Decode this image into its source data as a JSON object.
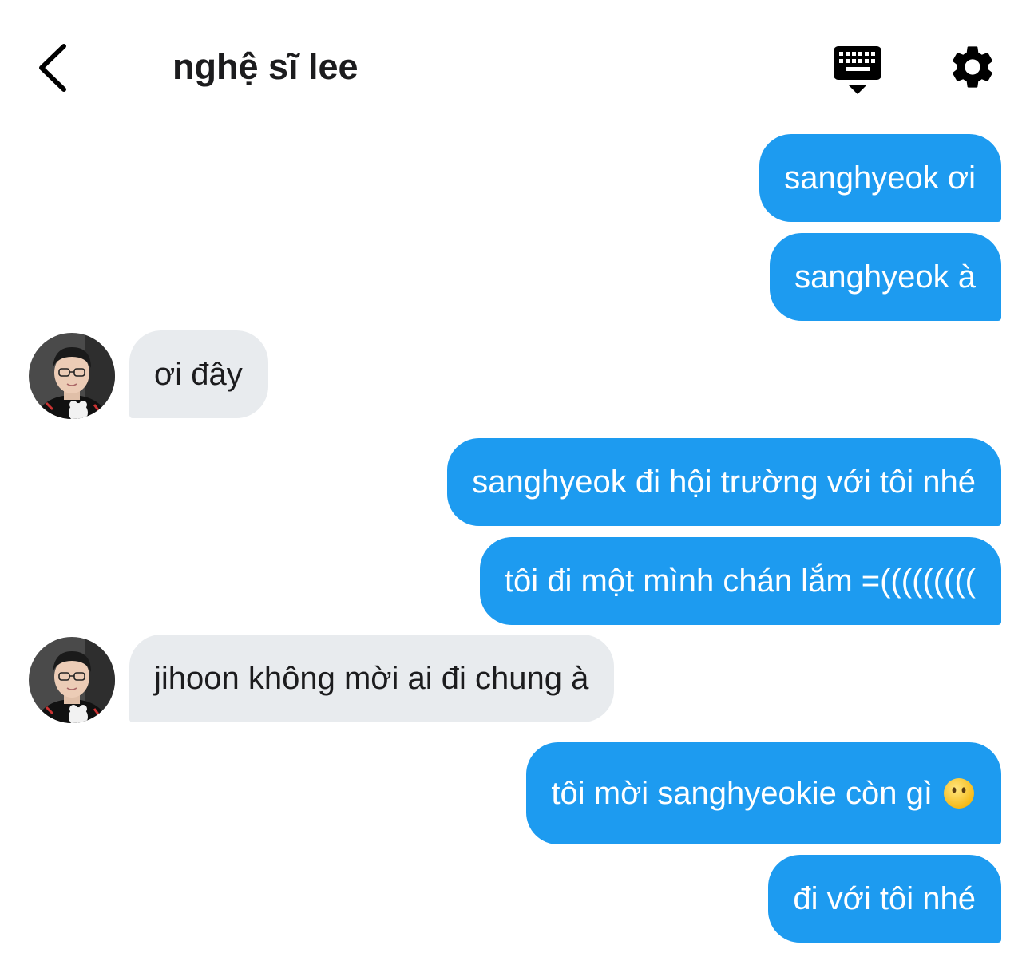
{
  "header": {
    "title": "nghệ sĩ lee",
    "back_icon": "chevron-left-icon",
    "keyboard_icon": "keyboard-icon",
    "settings_icon": "gear-icon"
  },
  "colors": {
    "sent_bubble": "#1d9bf0",
    "received_bubble": "#e8ebee",
    "text_dark": "#1c1c1e"
  },
  "messages": [
    {
      "from": "me",
      "text": "sanghyeok ơi"
    },
    {
      "from": "me",
      "text": "sanghyeok à"
    },
    {
      "from": "other",
      "text": "ơi đây"
    },
    {
      "from": "me",
      "text": "sanghyeok đi hội trường với tôi nhé"
    },
    {
      "from": "me",
      "text": "tôi đi một mình chán lắm =((((((((("
    },
    {
      "from": "other",
      "text": "jihoon không mời ai đi chung à"
    },
    {
      "from": "me",
      "text": "tôi mời sanghyeokie còn gì",
      "emoji": "no-mouth-face-emoji"
    },
    {
      "from": "me",
      "text": "đi với tôi nhé"
    }
  ]
}
